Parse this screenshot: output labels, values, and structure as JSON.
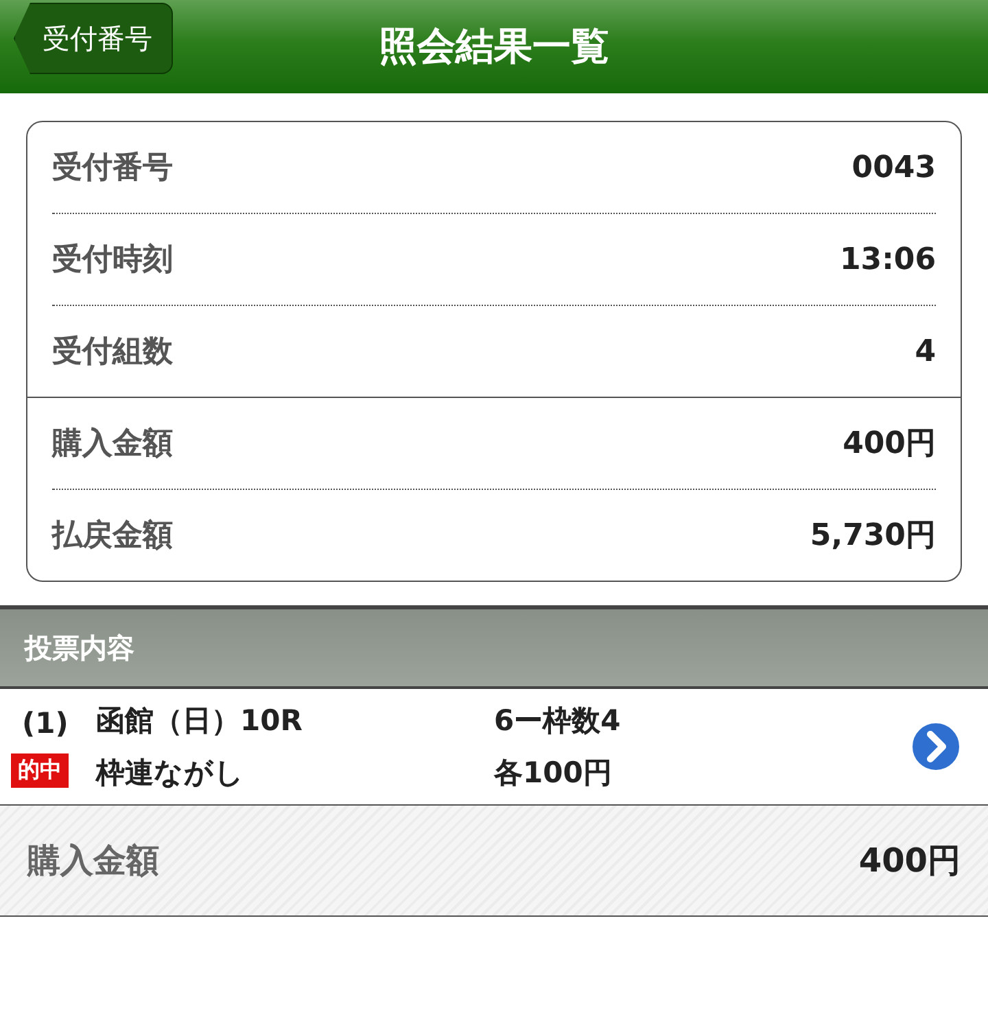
{
  "header": {
    "back_button": "受付番号",
    "title": "照会結果一覧"
  },
  "summary_groups": [
    [
      {
        "label": "受付番号",
        "value": "0043"
      },
      {
        "label": "受付時刻",
        "value": "13:06"
      },
      {
        "label": "受付組数",
        "value": "4"
      }
    ],
    [
      {
        "label": "購入金額",
        "value": "400円"
      },
      {
        "label": "払戻金額",
        "value": "5,730円"
      }
    ]
  ],
  "section_title": "投票内容",
  "bets": [
    {
      "number": "(1)",
      "badge": "的中",
      "race": "函館（日）10R",
      "bet_type": "枠連ながし",
      "combination": "6ー枠数4",
      "amount": "各100円"
    }
  ],
  "total": {
    "label": "購入金額",
    "value": "400円"
  }
}
